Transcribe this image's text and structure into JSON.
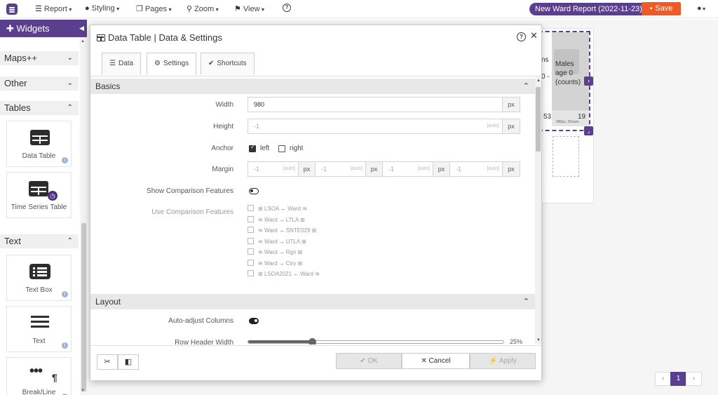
{
  "topbar": {
    "menus": [
      {
        "label": "Report",
        "icon": "hamburger-icon"
      },
      {
        "label": "Styling",
        "icon": "palette-icon"
      },
      {
        "label": "Pages",
        "icon": "copy-icon"
      },
      {
        "label": "Zoom",
        "icon": "zoom-icon"
      },
      {
        "label": "View",
        "icon": "map-pin-icon"
      }
    ],
    "help": "?",
    "report_title": "New Ward Report (2022-11-23)",
    "save_label": "Save",
    "colors": {
      "brand": "#5b3f8f",
      "save": "#f15a24"
    }
  },
  "sidebar": {
    "title": "Widgets",
    "sections": [
      {
        "label": "Maps++",
        "expanded": false
      },
      {
        "label": "Other",
        "expanded": false
      },
      {
        "label": "Tables",
        "expanded": true
      },
      {
        "label": "Text",
        "expanded": true
      }
    ],
    "widgets": {
      "data_table": "Data Table",
      "time_series_table": "Time Series Table",
      "text_box": "Text Box",
      "text": "Text",
      "break_line": "Break/Line"
    }
  },
  "canvas": {
    "col_header_partial": "ns",
    "col_header_partial2": "0 -",
    "males_header": "Males\nage 0\n(counts)",
    "cell_a": "53",
    "cell_b": "19",
    "size_note": "980px, 20rows",
    "pager": [
      "‹",
      "1",
      "›"
    ]
  },
  "modal": {
    "title": "Data Table | Data & Settings",
    "tabs": [
      {
        "label": "Data",
        "active": false
      },
      {
        "label": "Settings",
        "active": true
      },
      {
        "label": "Shortcuts",
        "active": false
      }
    ],
    "basics": {
      "title": "Basics",
      "width_label": "Width",
      "width_value": "980",
      "unit": "px",
      "height_label": "Height",
      "height_value": "-1",
      "auto_hint": "[auto]",
      "anchor_label": "Anchor",
      "anchor_left": "left",
      "anchor_right": "right",
      "anchor_left_checked": true,
      "anchor_right_checked": false,
      "margin_label": "Margin",
      "margin_values": [
        "-1",
        "-1",
        "-1",
        "-1"
      ],
      "show_comparison_label": "Show Comparison Features",
      "use_comparison_label": "Use Comparison Features",
      "comparisons": [
        {
          "from": "LSOA",
          "to": "Ward",
          "dir": "←"
        },
        {
          "from": "Ward",
          "to": "LTLA",
          "dir": "→"
        },
        {
          "from": "Ward",
          "to": "SNTE029",
          "dir": "→"
        },
        {
          "from": "Ward",
          "to": "UTLA",
          "dir": "→"
        },
        {
          "from": "Ward",
          "to": "Rgn",
          "dir": "→"
        },
        {
          "from": "Ward",
          "to": "Ctry",
          "dir": "→"
        },
        {
          "from": "LSOA2021",
          "to": "Ward",
          "dir": "←"
        }
      ]
    },
    "layout": {
      "title": "Layout",
      "auto_adjust_label": "Auto-adjust Columns",
      "auto_adjust_on": true,
      "row_header_label": "Row Header Width",
      "row_header_value": "25%",
      "row_header_fraction": 0.25
    },
    "footer": {
      "ok": "✔ OK",
      "cancel": "✕ Cancel",
      "apply": "⚡ Apply"
    }
  }
}
